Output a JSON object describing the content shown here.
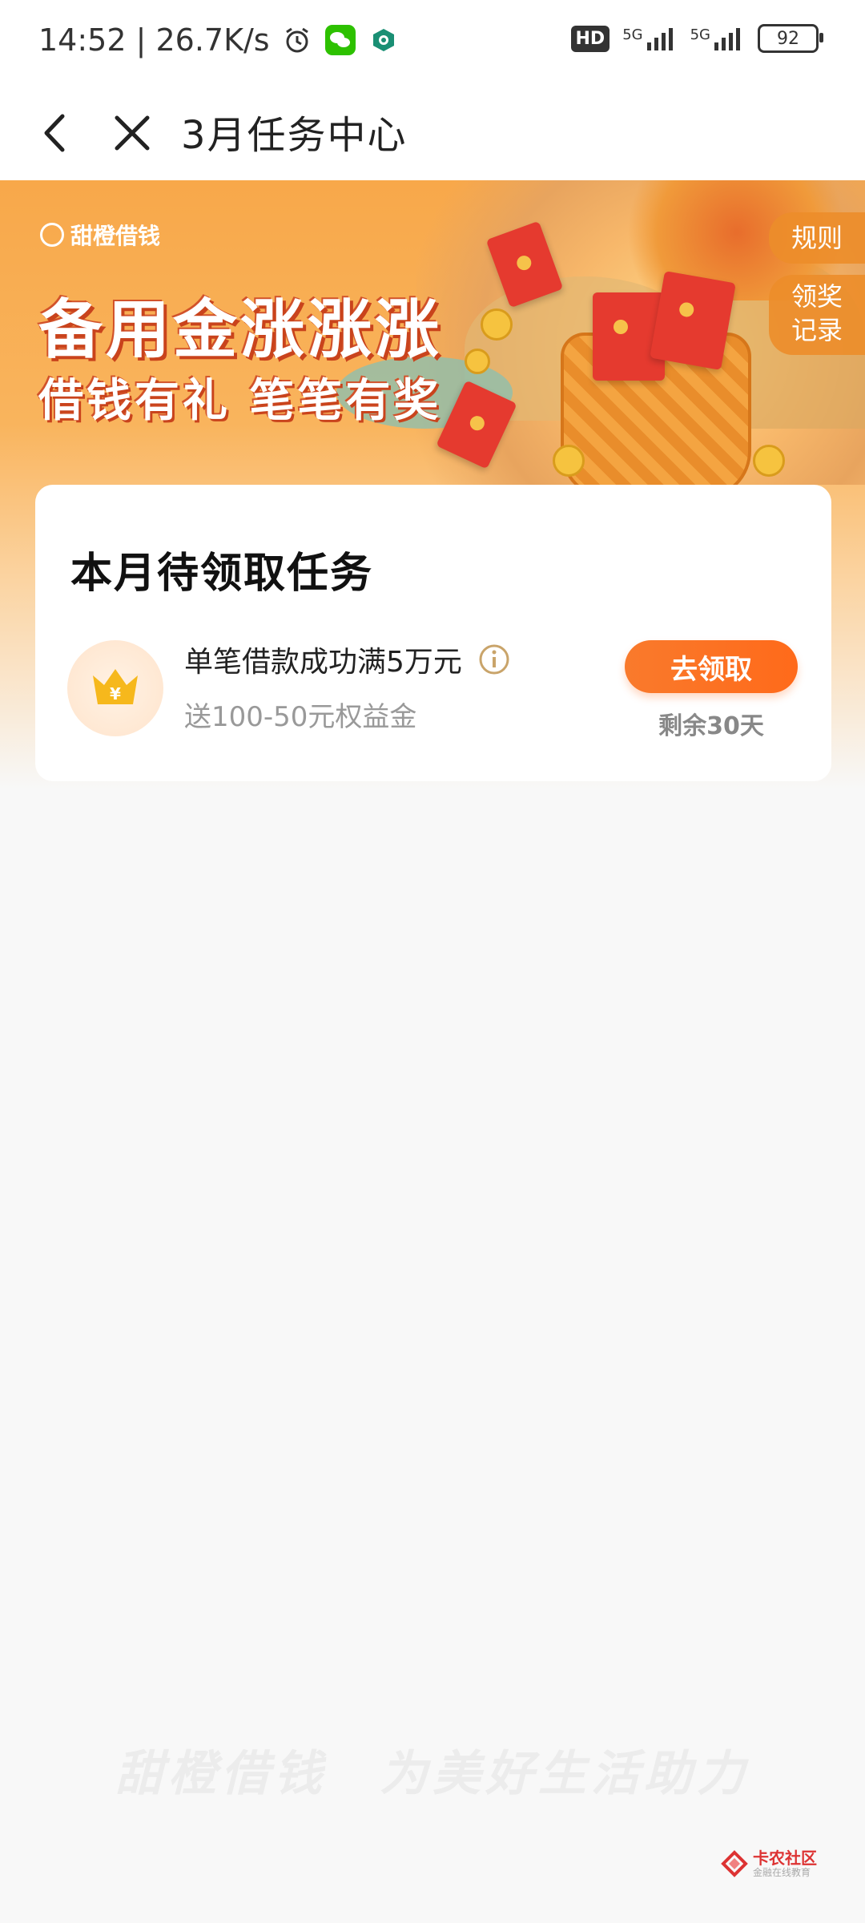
{
  "status_bar": {
    "time_speed": "14:52 | 26.7K/s",
    "hd": "HD",
    "signal1": "5G",
    "signal2": "5G",
    "battery": "92"
  },
  "nav": {
    "title": "3月任务中心"
  },
  "banner": {
    "brand": "甜橙借钱",
    "headline1": "备用金涨涨涨",
    "headline2": "借钱有礼 笔笔有奖",
    "rules_label": "规则",
    "records_label_line1": "领奖",
    "records_label_line2": "记录"
  },
  "card": {
    "title": "本月待领取任务",
    "task": {
      "name": "单笔借款成功满5万元",
      "reward": "送100-50元权益金",
      "button_label": "去领取",
      "days_left": "剩余30天"
    }
  },
  "footer": {
    "slogan": "甜橙借钱　为美好生活助力",
    "watermark_main": "卡农社区",
    "watermark_sub": "金融在线教育"
  }
}
